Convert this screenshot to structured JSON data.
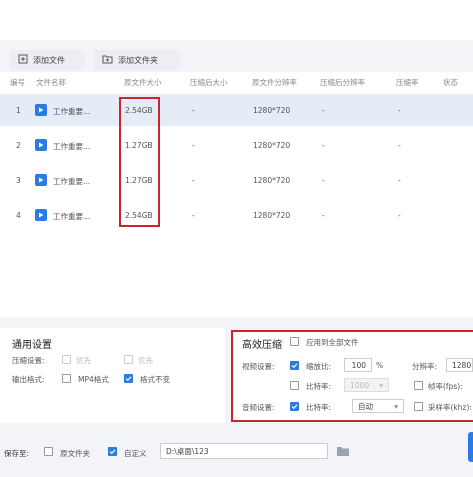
{
  "toolbar": {
    "add_file": "添加文件",
    "add_folder": "添加文件夹"
  },
  "columns": [
    "编号",
    "文件名称",
    "原文件大小",
    "压缩后大小",
    "原文件分辨率",
    "压缩后分辨率",
    "压缩率",
    "状态"
  ],
  "rows": [
    {
      "num": "1",
      "name": "工作重要...",
      "size": "2.54GB",
      "after": "-",
      "res": "1280*720",
      "after_res": "-",
      "ratio": "-"
    },
    {
      "num": "2",
      "name": "工作重要...",
      "size": "1.27GB",
      "after": "-",
      "res": "1280*720",
      "after_res": "-",
      "ratio": "-"
    },
    {
      "num": "3",
      "name": "工作重要...",
      "size": "1.27GB",
      "after": "-",
      "res": "1280*720",
      "after_res": "-",
      "ratio": "-"
    },
    {
      "num": "4",
      "name": "工作重要...",
      "size": "2.54GB",
      "after": "-",
      "res": "1280*720",
      "after_res": "-",
      "ratio": "-"
    }
  ],
  "general": {
    "title": "通用设置",
    "compress_label": "压缩设置:",
    "opt1": "优先",
    "opt2": "优先",
    "output_label": "输出格式:",
    "mp4": "MP4格式",
    "keep_format": "格式不变"
  },
  "advanced": {
    "title": "高效压缩",
    "apply_all": "应用到全部文件",
    "video_label": "视频设置:",
    "scale_label": "缩放比:",
    "scale_value": "100",
    "percent": "%",
    "resolution_label": "分辨率:",
    "resolution_value": "1280",
    "bitrate_label": "比特率:",
    "bitrate_value": "1000",
    "fps_label": "帧率(fps):",
    "audio_label": "音频设置:",
    "audio_bitrate_label": "比特率:",
    "audio_bitrate_value": "自动",
    "sample_label": "采样率(khz):"
  },
  "save": {
    "label": "保存至:",
    "source_folder": "原文件夹",
    "custom": "自定义",
    "path": "D:\\桌面\\123"
  },
  "colors": {
    "accent": "#2b7be4",
    "highlight": "#c9262c",
    "selected_row": "#e4ecf8"
  }
}
